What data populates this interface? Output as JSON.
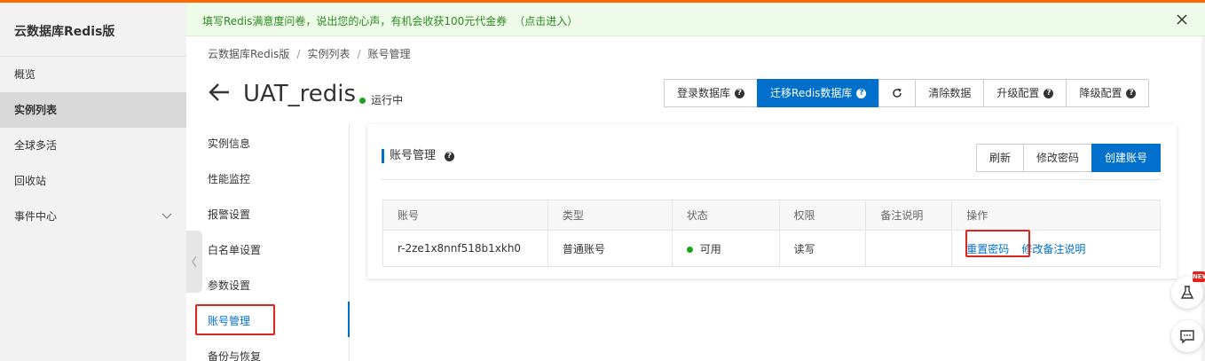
{
  "sidebar": {
    "title": "云数据库Redis版",
    "items": [
      {
        "label": "概览"
      },
      {
        "label": "实例列表"
      },
      {
        "label": "全球多活"
      },
      {
        "label": "回收站"
      },
      {
        "label": "事件中心"
      }
    ]
  },
  "notice": {
    "text": "填写Redis满意度问卷，说出您的心声，有机会收获100元代金券",
    "link": "（点击进入）"
  },
  "breadcrumb": [
    "云数据库Redis版",
    "实例列表",
    "账号管理"
  ],
  "instance": {
    "name": "UAT_redis",
    "status": "运行中"
  },
  "actions": {
    "login": "登录数据库",
    "migrate": "迁移Redis数据库",
    "clear": "清除数据",
    "upgrade": "升级配置",
    "downgrade": "降级配置"
  },
  "subnav": [
    {
      "label": "实例信息"
    },
    {
      "label": "性能监控"
    },
    {
      "label": "报警设置"
    },
    {
      "label": "白名单设置"
    },
    {
      "label": "参数设置"
    },
    {
      "label": "账号管理"
    },
    {
      "label": "备份与恢复"
    }
  ],
  "card": {
    "title": "账号管理",
    "buttons": {
      "refresh": "刷新",
      "change_password": "修改密码",
      "create_account": "创建账号"
    },
    "columns": [
      "账号",
      "类型",
      "状态",
      "权限",
      "备注说明",
      "操作"
    ],
    "rows": [
      {
        "account": "r-2ze1x8nnf518b1xkh0",
        "type": "普通账号",
        "status": "可用",
        "permission": "读写",
        "remark": "",
        "op_reset": "重置密码",
        "op_edit": "修改备注说明"
      }
    ]
  },
  "colors": {
    "primary": "#0070cc",
    "success": "#1ca31c",
    "highlight": "#e0241b",
    "top_bar": "#ff6a00"
  },
  "float": {
    "badge": "NEW"
  }
}
